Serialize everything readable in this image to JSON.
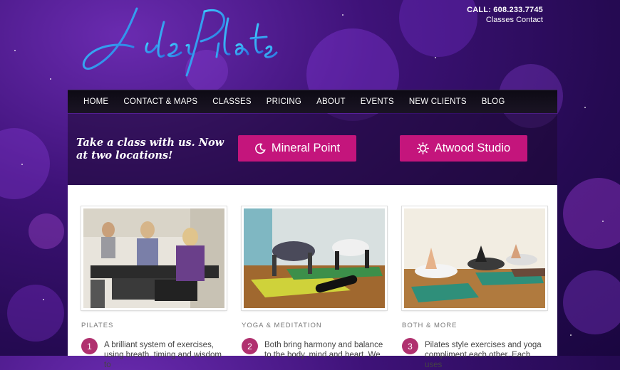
{
  "brand": {
    "logo_text": "Jules Pilates"
  },
  "header": {
    "call": "CALL: 608.233.7745",
    "link_classes": "Classes",
    "link_contact": "Contact"
  },
  "nav": {
    "items": [
      "HOME",
      "CONTACT & MAPS",
      "CLASSES",
      "PRICING",
      "ABOUT",
      "EVENTS",
      "NEW CLIENTS",
      "BLOG"
    ]
  },
  "hero": {
    "tagline": "Take a class with us. Now at two locations!",
    "location_1": "Mineral Point",
    "location_2": "Atwood Studio"
  },
  "cards": [
    {
      "number": "1",
      "category": "PILATES",
      "text": "A brilliant system of exercises, using breath, timing and wisdom to"
    },
    {
      "number": "2",
      "category": "YOGA & MEDITATION",
      "text": "Both bring harmony and balance to the body, mind and heart. We"
    },
    {
      "number": "3",
      "category": "BOTH & MORE",
      "text": "Pilates style exercises and yoga compliment each other. Each uses"
    }
  ],
  "colors": {
    "accent": "#c4157c",
    "badge": "#b0316f",
    "nav_bg": "#120e1a"
  }
}
